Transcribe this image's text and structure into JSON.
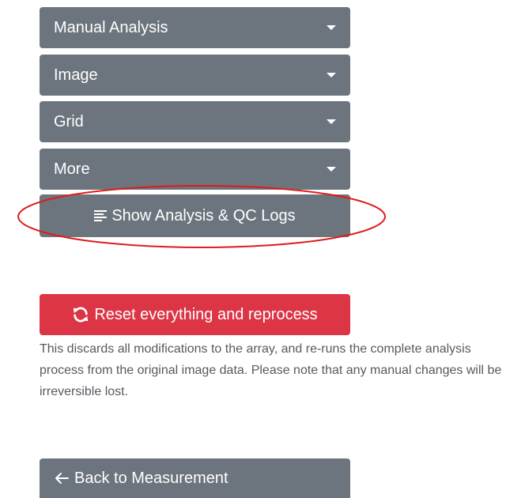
{
  "dropdowns": [
    {
      "label": "Manual Analysis",
      "icon": "caret-down-icon"
    },
    {
      "label": "Image",
      "icon": "caret-down-icon"
    },
    {
      "label": "Grid",
      "icon": "caret-down-icon"
    },
    {
      "label": "More",
      "icon": "caret-down-icon"
    }
  ],
  "logs_button": {
    "label": "Show Analysis & QC Logs",
    "icon": "align-left-icon"
  },
  "annotation": {
    "color": "#e01b1b",
    "shape": "ellipse"
  },
  "reset": {
    "label": "Reset everything and reprocess",
    "icon": "sync-icon",
    "note": "This discards all modifications to the array, and re-runs the complete analysis process from the original image data. Please note that any manual changes will be irreversible lost."
  },
  "back_button": {
    "label": "Back to Measurement",
    "icon": "arrow-left-icon"
  },
  "colors": {
    "secondary": "#6c757d",
    "danger": "#dc3545",
    "text_muted": "#555a60"
  }
}
